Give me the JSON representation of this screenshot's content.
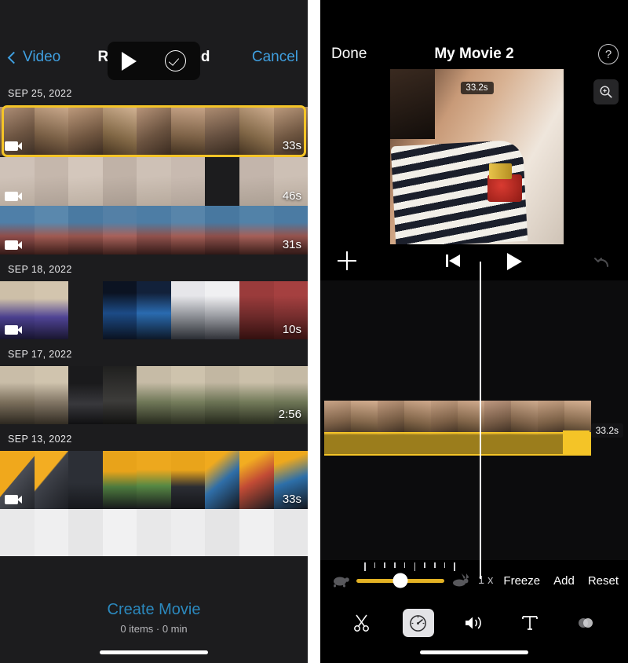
{
  "left": {
    "nav": {
      "back_label": "Video",
      "title": "Recently Added",
      "cancel_label": "Cancel"
    },
    "sections": [
      {
        "date": "SEP 25, 2022",
        "clips": [
          {
            "duration": "33s",
            "selected": true
          },
          {
            "duration": "46s",
            "selected": false
          },
          {
            "duration": "31s",
            "selected": false
          }
        ]
      },
      {
        "date": "SEP 18, 2022",
        "clips": [
          {
            "duration": "10s",
            "selected": false
          }
        ]
      },
      {
        "date": "SEP 17, 2022",
        "clips": [
          {
            "duration": "2:56",
            "selected": false
          }
        ]
      },
      {
        "date": "SEP 13, 2022",
        "clips": [
          {
            "duration": "33s",
            "selected": false
          }
        ]
      }
    ],
    "footer": {
      "create_label": "Create Movie",
      "summary": "0 items · 0 min"
    }
  },
  "right": {
    "nav": {
      "done_label": "Done",
      "title": "My Movie 2",
      "help_icon": "question-mark-icon",
      "zoom_icon": "magnifier-plus-icon"
    },
    "preview": {
      "time_badge": "33.2s"
    },
    "controls": {
      "add_icon": "plus-icon",
      "skip_start_icon": "skip-to-start-icon",
      "play_icon": "play-icon",
      "undo_icon": "undo-icon"
    },
    "timeline": {
      "clip_duration": "33.2s"
    },
    "speed": {
      "slow_icon": "turtle-icon",
      "fast_icon": "rabbit-icon",
      "rate_label": "1 x",
      "freeze_label": "Freeze",
      "add_label": "Add",
      "reset_label": "Reset"
    },
    "tools": [
      {
        "name": "scissors-icon",
        "label": "Cut",
        "active": false
      },
      {
        "name": "speedometer-icon",
        "label": "Speed",
        "active": true
      },
      {
        "name": "volume-icon",
        "label": "Volume",
        "active": false
      },
      {
        "name": "text-icon",
        "label": "Titles",
        "active": false
      },
      {
        "name": "filters-icon",
        "label": "Filters",
        "active": false
      }
    ]
  },
  "colors": {
    "accent_blue": "#3f9fe0",
    "accent_yellow": "#f4c427",
    "panel_bg": "#1c1c1e"
  }
}
